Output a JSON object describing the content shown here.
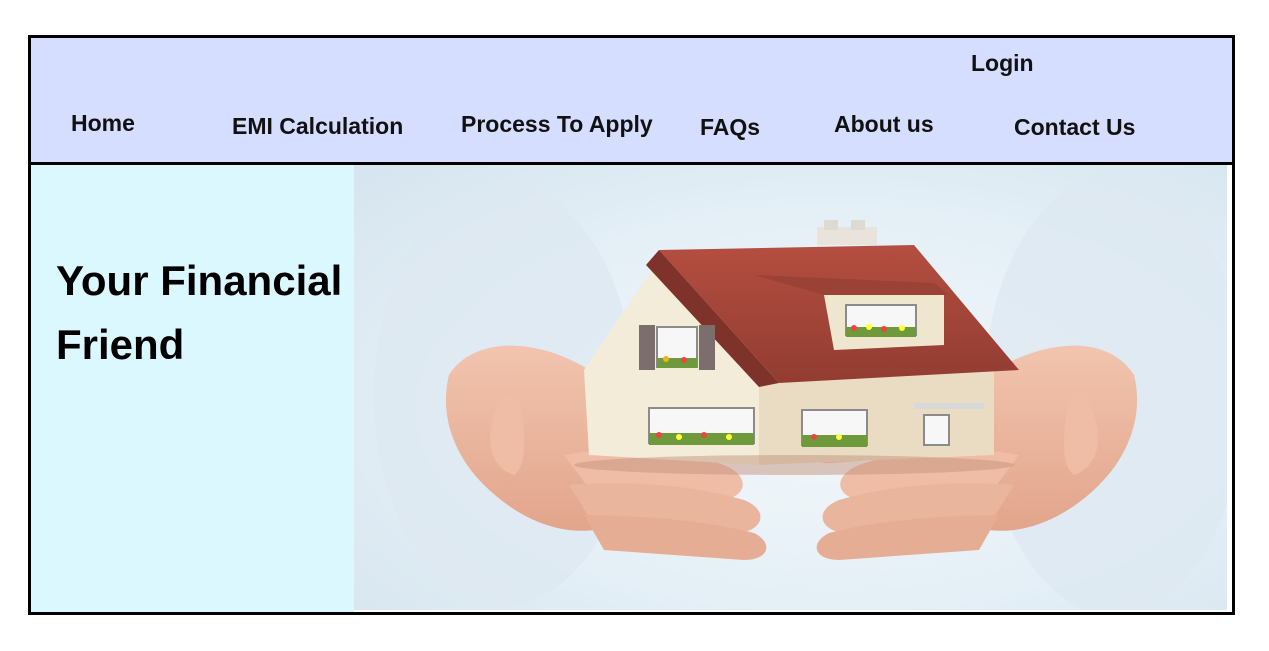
{
  "nav": {
    "login": "Login",
    "items": [
      {
        "label": "Home"
      },
      {
        "label": "EMI Calculation"
      },
      {
        "label": "Process To Apply"
      },
      {
        "label": "FAQs"
      },
      {
        "label": "About us"
      },
      {
        "label": "Contact Us"
      }
    ]
  },
  "hero": {
    "title_line1": "Your Financial",
    "title_line2": "Friend",
    "image_icon": "hands-holding-house-icon"
  },
  "colors": {
    "nav_background": "#d6deff",
    "hero_panel": "#dcf8ff",
    "border": "#000000",
    "roof": "#a8453a"
  }
}
